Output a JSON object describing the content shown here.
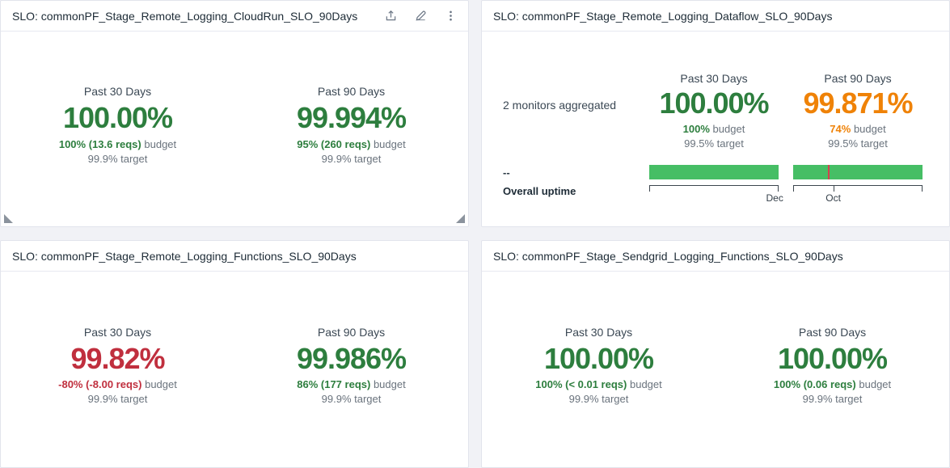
{
  "page": {
    "background": "#f1f2f6"
  },
  "colors": {
    "ok": "#2d7e3e",
    "warn": "#ef8207",
    "critical": "#c02f3e",
    "bar_fill": "#46be65",
    "bar_marker": "#d6404e",
    "muted_text": "#6a737d",
    "title_text": "#1d2b36"
  },
  "strings": {
    "budget": "budget"
  },
  "widgets": [
    {
      "title": "SLO: commonPF_Stage_Remote_Logging_CloudRun_SLO_90Days",
      "stats": [
        {
          "period": "Past 30 Days",
          "value": "100.00%",
          "color": "#2d7e3e",
          "budget": "100% (13.6 reqs)",
          "target": "99.9% target"
        },
        {
          "period": "Past 90 Days",
          "value": "99.994%",
          "color": "#2d7e3e",
          "budget": "95% (260 reqs)",
          "target": "99.9% target"
        }
      ]
    },
    {
      "title": "SLO: commonPF_Stage_Remote_Logging_Dataflow_SLO_90Days",
      "aggregate_label": "2 monitors aggregated",
      "overall_uptime_value": "--",
      "overall_uptime_label": "Overall uptime",
      "stats": [
        {
          "period": "Past 30 Days",
          "value": "100.00%",
          "color": "#2d7e3e",
          "budget": "100%",
          "target": "99.5% target",
          "bar": {
            "fill": "#46be65",
            "marker_display": "none",
            "marker_left": "0%",
            "marker_color": "#d6404e",
            "mid_tick_display": "none",
            "mid_tick_left": "0%",
            "axis_label": "Dec",
            "axis_label_left": "97%"
          }
        },
        {
          "period": "Past 90 Days",
          "value": "99.871%",
          "color": "#ef8207",
          "budget": "74%",
          "target": "99.5% target",
          "bar": {
            "fill": "#46be65",
            "marker_display": "block",
            "marker_left": "27%",
            "marker_color": "#d6404e",
            "mid_tick_display": "block",
            "mid_tick_left": "31%",
            "axis_label": "Oct",
            "axis_label_left": "31%"
          }
        }
      ]
    },
    {
      "title": "SLO: commonPF_Stage_Remote_Logging_Functions_SLO_90Days",
      "stats": [
        {
          "period": "Past 30 Days",
          "value": "99.82%",
          "color": "#c02f3e",
          "budget": "-80% (-8.00 reqs)",
          "target": "99.9% target"
        },
        {
          "period": "Past 90 Days",
          "value": "99.986%",
          "color": "#2d7e3e",
          "budget": "86% (177 reqs)",
          "target": "99.9% target"
        }
      ]
    },
    {
      "title": "SLO: commonPF_Stage_Sendgrid_Logging_Functions_SLO_90Days",
      "stats": [
        {
          "period": "Past 30 Days",
          "value": "100.00%",
          "color": "#2d7e3e",
          "budget": "100% (< 0.01 reqs)",
          "target": "99.9% target"
        },
        {
          "period": "Past 90 Days",
          "value": "100.00%",
          "color": "#2d7e3e",
          "budget": "100% (0.06 reqs)",
          "target": "99.9% target"
        }
      ]
    }
  ]
}
